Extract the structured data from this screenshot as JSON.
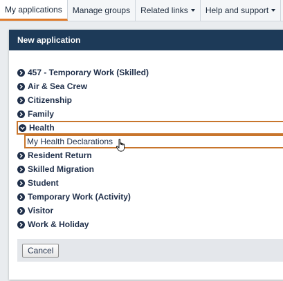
{
  "topnav": {
    "tabs": [
      {
        "label": "My applications",
        "active": true
      },
      {
        "label": "Manage groups"
      },
      {
        "label": "Related links",
        "dropdown": true
      },
      {
        "label": "Help and support",
        "dropdown": true
      }
    ]
  },
  "dialog": {
    "title": "New application",
    "items": [
      {
        "label": "457 - Temporary Work (Skilled)",
        "icon": "chevron-right-circle-icon"
      },
      {
        "label": "Air & Sea Crew",
        "icon": "chevron-right-circle-icon"
      },
      {
        "label": "Citizenship",
        "icon": "chevron-right-circle-icon"
      },
      {
        "label": "Family",
        "icon": "chevron-right-circle-icon"
      },
      {
        "label": "Health",
        "icon": "chevron-down-circle-icon",
        "expanded": true
      },
      {
        "label": "Resident Return",
        "icon": "chevron-right-circle-icon"
      },
      {
        "label": "Skilled Migration",
        "icon": "chevron-right-circle-icon"
      },
      {
        "label": "Student",
        "icon": "chevron-right-circle-icon"
      },
      {
        "label": "Temporary Work (Activity)",
        "icon": "chevron-right-circle-icon"
      },
      {
        "label": "Visitor",
        "icon": "chevron-right-circle-icon"
      },
      {
        "label": "Work & Holiday",
        "icon": "chevron-right-circle-icon"
      }
    ],
    "health_subitem": "My Health Declarations",
    "cancel_label": "Cancel"
  },
  "colors": {
    "accent": "#e07b2a",
    "header_bg": "#1d3a58",
    "highlight_border": "#c8752c"
  }
}
